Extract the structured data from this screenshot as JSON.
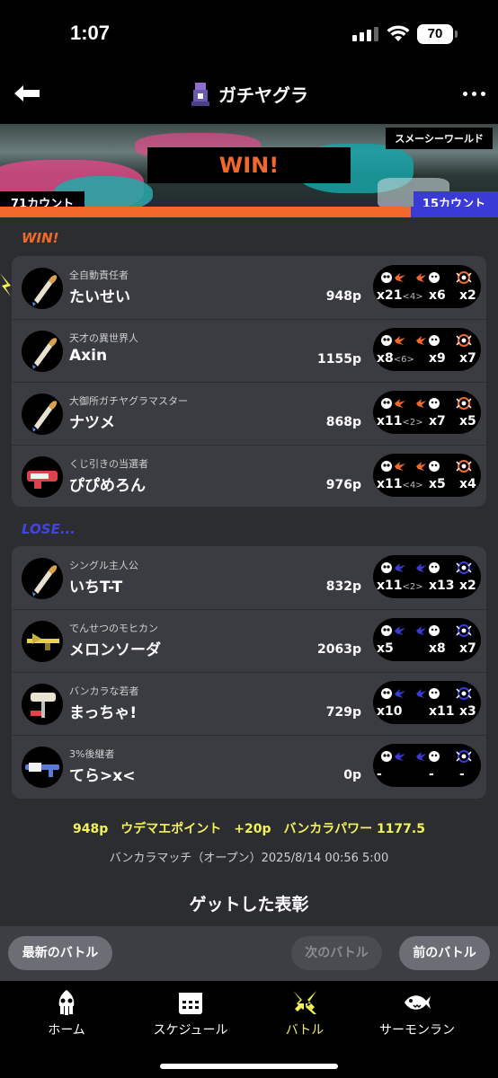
{
  "status_bar": {
    "time": "1:07",
    "battery": "70"
  },
  "header": {
    "title": "ガチヤグラ"
  },
  "banner": {
    "stage": "スメーシーワールド",
    "result": "WIN!",
    "left_count": "71カウント",
    "right_count": "15カウント",
    "left_count_value": 71,
    "right_count_value": 15,
    "colors": {
      "alpha": "#f2682a",
      "bravo": "#3a3ad6"
    }
  },
  "win_section": {
    "label": "WIN!",
    "color": "#f2682a",
    "players": [
      {
        "byname": "全自動責任者",
        "name": "たいせい",
        "points": "948p",
        "k": "x21",
        "assist": "<4>",
        "d": "x6",
        "sp": "x2",
        "weapon_icon": "brush-icon"
      },
      {
        "byname": "天才の異世界人",
        "name": "Axin",
        "points": "1155p",
        "k": "x8",
        "assist": "<6>",
        "d": "x9",
        "sp": "x7",
        "weapon_icon": "brush-icon"
      },
      {
        "byname": "大御所ガチヤグラマスター",
        "name": "ナツメ",
        "points": "868p",
        "k": "x11",
        "assist": "<2>",
        "d": "x7",
        "sp": "x5",
        "weapon_icon": "brush-icon"
      },
      {
        "byname": "くじ引きの当選者",
        "name": "ぴぴめろん",
        "points": "976p",
        "k": "x11",
        "assist": "<4>",
        "d": "x5",
        "sp": "x4",
        "weapon_icon": "blaster-icon"
      }
    ]
  },
  "lose_section": {
    "label": "LOSE...",
    "color": "#4444e0",
    "players": [
      {
        "byname": "シングル主人公",
        "name": "いちT-T",
        "points": "832p",
        "k": "x11",
        "assist": "<2>",
        "d": "x13",
        "sp": "x2",
        "weapon_icon": "brush-icon"
      },
      {
        "byname": "でんせつのモヒカン",
        "name": "メロンソーダ",
        "points": "2063p",
        "k": "x5",
        "assist": "",
        "d": "x8",
        "sp": "x7",
        "weapon_icon": "charger-icon"
      },
      {
        "byname": "バンカラな若者",
        "name": "まっちゃ!",
        "points": "729p",
        "k": "x10",
        "assist": "",
        "d": "x11",
        "sp": "x3",
        "weapon_icon": "roller-icon"
      },
      {
        "byname": "3%後継者",
        "name": "てら>x<",
        "points": "0p",
        "k": "-",
        "assist": "",
        "d": "-",
        "sp": "-",
        "weapon_icon": "shooter-icon"
      }
    ]
  },
  "summary": {
    "line1": "948p　ウデマエポイント　+20p　バンカラパワー 1177.5",
    "line2": "バンカラマッチ（オープン）2025/8/14 00:56 5:00"
  },
  "gear_title": "ゲットした表彰",
  "actions": {
    "latest": "最新のバトル",
    "next": "次のバトル",
    "prev": "前のバトル"
  },
  "tabs": [
    {
      "label": "ホーム",
      "icon": "squid-icon"
    },
    {
      "label": "スケジュール",
      "icon": "calendar-icon"
    },
    {
      "label": "バトル",
      "icon": "battle-icon",
      "active": true
    },
    {
      "label": "サーモンラン",
      "icon": "salmon-icon"
    }
  ],
  "colors": {
    "active_tab": "#f3f25b",
    "summary": "#f3f25b"
  }
}
